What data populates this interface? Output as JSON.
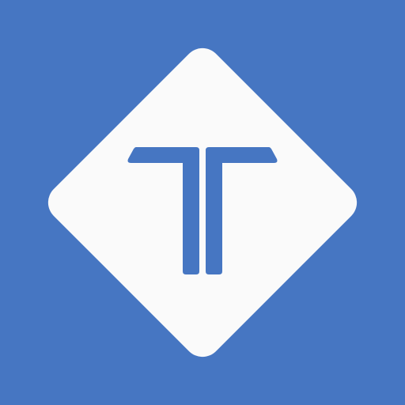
{
  "icon": {
    "name": "t-logo-icon",
    "colors": {
      "background": "#4676C2",
      "diamond": "#FAFAFA",
      "glyph": "#4676C2"
    }
  }
}
